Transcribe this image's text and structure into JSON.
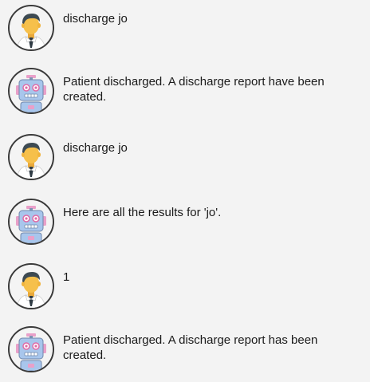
{
  "messages": [
    {
      "sender": "user",
      "avatar_icon": "user-avatar-icon",
      "text": "discharge jo"
    },
    {
      "sender": "bot",
      "avatar_icon": "robot-avatar-icon",
      "text": "Patient discharged. A discharge report have been created."
    },
    {
      "sender": "user",
      "avatar_icon": "user-avatar-icon",
      "text": "discharge jo"
    },
    {
      "sender": "bot",
      "avatar_icon": "robot-avatar-icon",
      "text": "Here are all the results for 'jo'."
    },
    {
      "sender": "user",
      "avatar_icon": "user-avatar-icon",
      "text": "1"
    },
    {
      "sender": "bot",
      "avatar_icon": "robot-avatar-icon",
      "text": "Patient discharged. A discharge report has been created."
    }
  ],
  "colors": {
    "background": "#f3f3f3",
    "avatar_border": "#3a3a3a",
    "text": "#1a1a1a",
    "user_skin": "#f6c04b",
    "user_hair": "#3d4a52",
    "robot_body": "#a8c6ec",
    "robot_head_accent": "#e9a0c9"
  }
}
